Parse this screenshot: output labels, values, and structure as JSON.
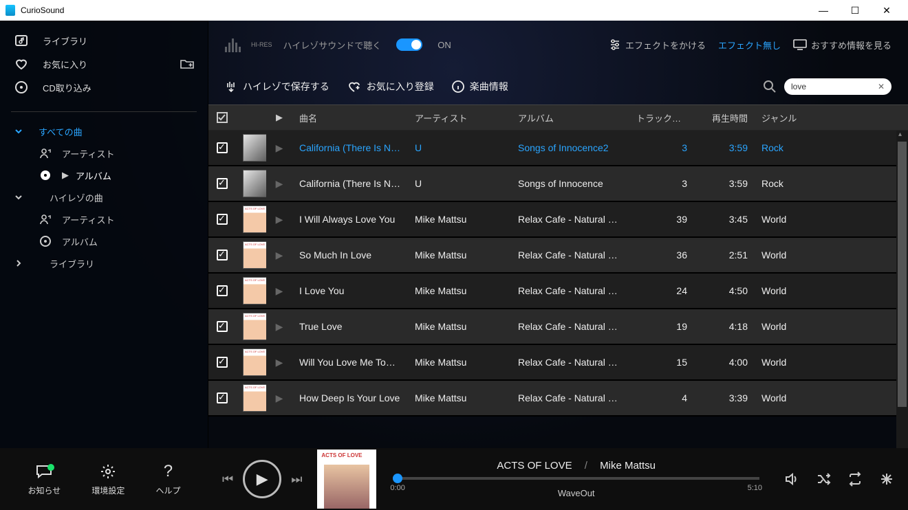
{
  "window": {
    "title": "CurioSound"
  },
  "sidebar": {
    "library": "ライブラリ",
    "favorites": "お気に入り",
    "cd_import": "CD取り込み",
    "all_songs": "すべての曲",
    "artist": "アーティスト",
    "album": "アルバム",
    "hires_songs": "ハイレゾの曲",
    "artist2": "アーティスト",
    "album2": "アルバム",
    "library2": "ライブラリ"
  },
  "toolbar": {
    "hires_short": "HI-RES",
    "hires_listen": "ハイレゾサウンドで聴く",
    "on": "ON",
    "apply_effect": "エフェクトをかける",
    "no_effect": "エフェクト無し",
    "recommend": "おすすめ情報を見る"
  },
  "actions": {
    "save_hires": "ハイレゾで保存する",
    "favorite_reg": "お気に入り登録",
    "song_info": "楽曲情報"
  },
  "search": {
    "value": "love"
  },
  "columns": {
    "title": "曲名",
    "artist": "アーティスト",
    "album": "アルバム",
    "track": "トラック番号",
    "duration": "再生時間",
    "genre": "ジャンル"
  },
  "rows": [
    {
      "title": "California (There Is N…",
      "artist": "U",
      "album": "Songs of Innocence2",
      "track": "3",
      "dur": "3:59",
      "genre": "Rock",
      "art": "bw",
      "sel": true
    },
    {
      "title": "California (There Is N…",
      "artist": "U",
      "album": "Songs of Innocence",
      "track": "3",
      "dur": "3:59",
      "genre": "Rock",
      "art": "bw"
    },
    {
      "title": "I Will Always Love You",
      "artist": "Mike Mattsu",
      "album": "Relax Cafe - Natural G…",
      "track": "39",
      "dur": "3:45",
      "genre": "World",
      "art": "aol"
    },
    {
      "title": "So Much In Love",
      "artist": "Mike Mattsu",
      "album": "Relax Cafe - Natural G…",
      "track": "36",
      "dur": "2:51",
      "genre": "World",
      "art": "aol"
    },
    {
      "title": "I Love You",
      "artist": "Mike Mattsu",
      "album": "Relax Cafe - Natural G…",
      "track": "24",
      "dur": "4:50",
      "genre": "World",
      "art": "aol"
    },
    {
      "title": "True Love",
      "artist": "Mike Mattsu",
      "album": "Relax Cafe - Natural G…",
      "track": "19",
      "dur": "4:18",
      "genre": "World",
      "art": "aol"
    },
    {
      "title": "Will You Love Me To…",
      "artist": "Mike Mattsu",
      "album": "Relax Cafe - Natural G…",
      "track": "15",
      "dur": "4:00",
      "genre": "World",
      "art": "aol"
    },
    {
      "title": "How Deep Is Your Love",
      "artist": "Mike Mattsu",
      "album": "Relax Cafe - Natural G…",
      "track": "4",
      "dur": "3:39",
      "genre": "World",
      "art": "aol"
    }
  ],
  "footer": {
    "notify": "お知らせ",
    "settings": "環境設定",
    "help": "ヘルプ"
  },
  "player": {
    "album": "ACTS OF LOVE",
    "artist": "Mike Mattsu",
    "elapsed": "0:00",
    "total": "5:10",
    "output": "WaveOut"
  }
}
